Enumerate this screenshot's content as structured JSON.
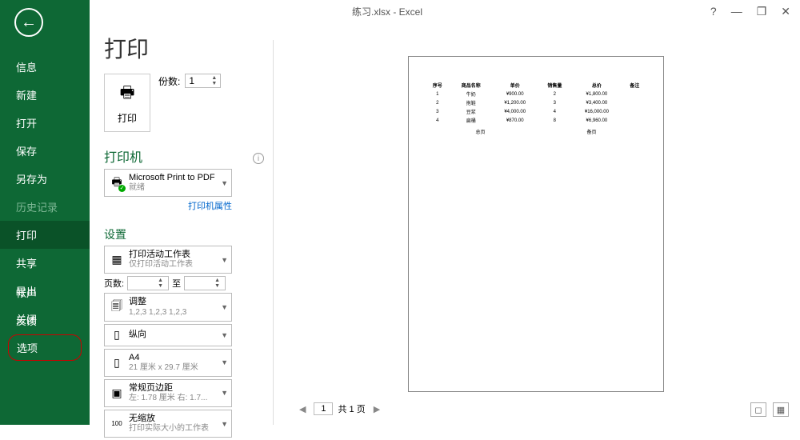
{
  "title_bar": "练习.xlsx  -  Excel",
  "win": {
    "help": "?",
    "min": "—",
    "restore": "❐",
    "close": "✕"
  },
  "sidebar": {
    "items": [
      "信息",
      "新建",
      "打开",
      "保存",
      "另存为",
      "历史记录",
      "打印",
      "共享",
      "导出",
      "关闭"
    ],
    "bottom": [
      "帐户",
      "反馈",
      "选项"
    ]
  },
  "page_title": "打印",
  "print_button": "打印",
  "copies_label": "份数:",
  "copies_value": "1",
  "printer_heading": "打印机",
  "printer": {
    "name": "Microsoft Print to PDF",
    "status": "就绪"
  },
  "printer_props_link": "打印机属性",
  "settings_heading": "设置",
  "settings": {
    "sheets": {
      "title": "打印活动工作表",
      "sub": "仅打印活动工作表"
    },
    "pages_label": "页数:",
    "pages_to": "至",
    "collate": {
      "title": "调整",
      "sub": "1,2,3    1,2,3    1,2,3"
    },
    "orientation": {
      "title": "纵向"
    },
    "paper": {
      "title": "A4",
      "sub": "21 厘米 x 29.7 厘米"
    },
    "margins": {
      "title": "常规页边距",
      "sub": "左: 1.78 厘米   右: 1.7..."
    },
    "scaling": {
      "title": "无缩放",
      "sub": "打印实际大小的工作表"
    }
  },
  "page_nav": {
    "current": "1",
    "total_label": "共 1 页"
  },
  "preview": {
    "headers": [
      "序号",
      "商品名称",
      "单价",
      "销售量",
      "总价",
      "备注"
    ],
    "rows": [
      [
        "1",
        "牛奶",
        "¥900.00",
        "2",
        "¥1,800.00",
        ""
      ],
      [
        "2",
        "拖鞋",
        "¥1,200.00",
        "3",
        "¥3,400.00",
        ""
      ],
      [
        "3",
        "豆浆",
        "¥4,000.00",
        "4",
        "¥16,000.00",
        ""
      ],
      [
        "4",
        "扁桶",
        "¥870.00",
        "8",
        "¥6,960.00",
        ""
      ]
    ],
    "footer_left": "总页",
    "footer_right": "备页"
  }
}
